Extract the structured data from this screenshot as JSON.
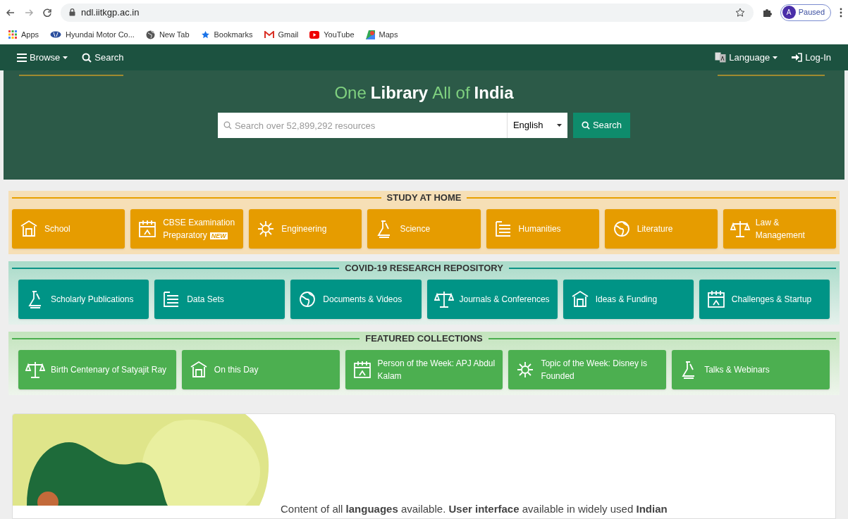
{
  "browser": {
    "url": "ndl.iitkgp.ac.in",
    "profile_initial": "A",
    "profile_status": "Paused",
    "bookmarks": [
      {
        "label": "Apps",
        "kind": "apps"
      },
      {
        "label": "Hyundai Motor Co...",
        "kind": "hyundai"
      },
      {
        "label": "New Tab",
        "kind": "globe"
      },
      {
        "label": "Bookmarks",
        "kind": "star"
      },
      {
        "label": "Gmail",
        "kind": "gmail"
      },
      {
        "label": "YouTube",
        "kind": "youtube"
      },
      {
        "label": "Maps",
        "kind": "maps"
      }
    ]
  },
  "nav": {
    "left": [
      {
        "label": "Browse",
        "kind": "menu"
      },
      {
        "label": "Search",
        "kind": "search"
      }
    ],
    "right": [
      {
        "label": "Language",
        "kind": "language"
      },
      {
        "label": "Log-In",
        "kind": "login"
      }
    ]
  },
  "hero": {
    "title_parts": [
      {
        "text": "One",
        "bold": false
      },
      {
        "text": "Library",
        "bold": true
      },
      {
        "text": "All of",
        "bold": false
      },
      {
        "text": "India",
        "bold": true
      }
    ],
    "search_placeholder": "Search over 52,899,292 resources",
    "language": "English",
    "search_button": "Search"
  },
  "sections": [
    {
      "title": "STUDY AT HOME",
      "kind": "orange",
      "items": [
        {
          "label": "School"
        },
        {
          "label": "CBSE Examination Preparatory",
          "badge": "NEW"
        },
        {
          "label": "Engineering"
        },
        {
          "label": "Science"
        },
        {
          "label": "Humanities"
        },
        {
          "label": "Literature"
        },
        {
          "label": "Law & Management"
        }
      ]
    },
    {
      "title": "COVID-19 RESEARCH REPOSITORY",
      "kind": "teal",
      "items": [
        {
          "label": "Scholarly Publications"
        },
        {
          "label": "Data Sets"
        },
        {
          "label": "Documents & Videos"
        },
        {
          "label": "Journals & Conferences"
        },
        {
          "label": "Ideas & Funding"
        },
        {
          "label": "Challenges & Startup"
        }
      ]
    },
    {
      "title": "FEATURED COLLECTIONS",
      "kind": "green",
      "items": [
        {
          "label": "Birth Centenary of Satyajit Ray"
        },
        {
          "label": "On this Day"
        },
        {
          "label": "Person of the Week: APJ Abdul Kalam"
        },
        {
          "label": "Topic of the Week: Disney is Founded"
        },
        {
          "label": "Talks & Webinars"
        }
      ]
    }
  ],
  "languages_card": {
    "text": "Content of all **languages** available. **User interface** available in widely used **Indian**"
  }
}
